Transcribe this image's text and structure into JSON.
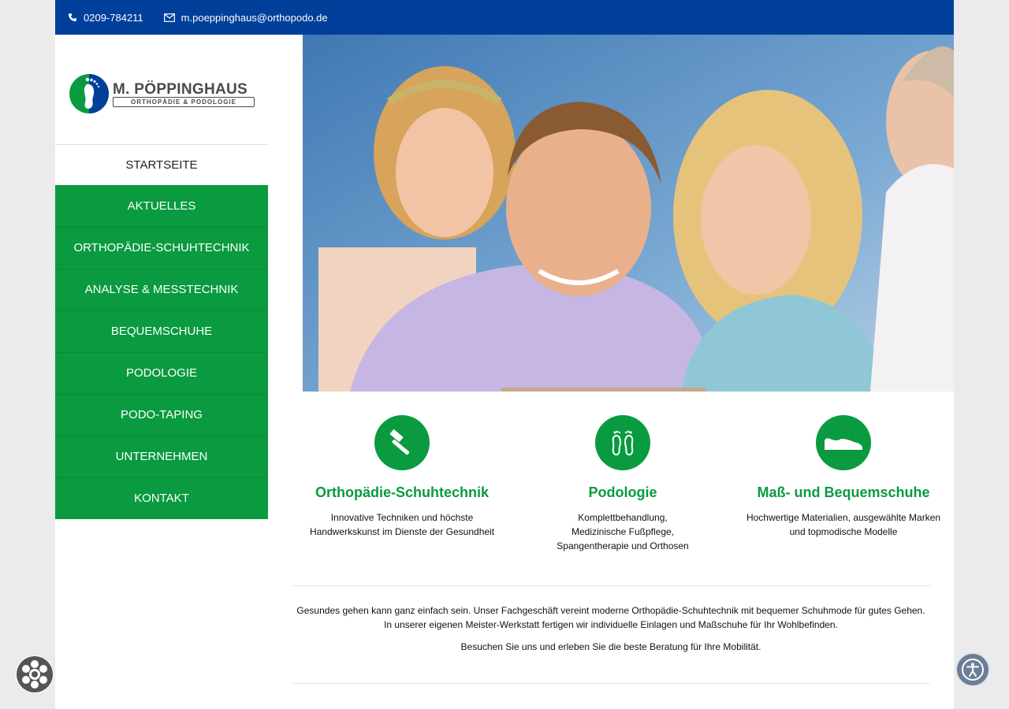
{
  "topbar": {
    "phone": "0209-784211",
    "email": "m.poeppinghaus@orthopodo.de",
    "background": "#003f9a"
  },
  "logo": {
    "name": "M. PÖPPINGHAUS",
    "subtitle": "ORTHOPÄDIE & PODOLOGIE"
  },
  "nav": {
    "start": "STARTSEITE",
    "items": [
      {
        "label": "AKTUELLES"
      },
      {
        "label": "ORTHOPÄDIE-SCHUHTECHNIK"
      },
      {
        "label": "ANALYSE & MESSTECHNIK"
      },
      {
        "label": "BEQUEMSCHUHE"
      },
      {
        "label": "PODOLOGIE"
      },
      {
        "label": "PODO-TAPING"
      },
      {
        "label": "UNTERNEHMEN"
      },
      {
        "label": "KONTAKT"
      }
    ],
    "accent": "#0a9a3f"
  },
  "features": [
    {
      "title": "Orthopädie-Schuhtechnik",
      "text_lines": [
        "Innovative Techniken und höchste",
        "Handwerkskunst im Dienste der Gesundheit"
      ],
      "icon": "hammer-icon"
    },
    {
      "title": "Podologie",
      "text_lines": [
        "Komplettbehandlung,",
        "Medizinische Fußpflege,",
        "Spangentherapie und Orthosen"
      ],
      "icon": "feet-icon"
    },
    {
      "title": "Maß- und Bequemschuhe",
      "text_lines": [
        "Hochwertige Materialien, ausgewählte Marken",
        "und topmodische Modelle"
      ],
      "icon": "shoe-icon"
    }
  ],
  "intro": {
    "line1": "Gesundes gehen kann ganz einfach sein. Unser Fachgeschäft vereint moderne Orthopädie-Schuhtechnik mit bequemer Schuhmode für gutes Gehen.",
    "line2": "In unserer eigenen Meister-Werkstatt fertigen wir individuelle Einlagen und Maßschuhe für Ihr Wohlbefinden.",
    "line3": "Besuchen Sie uns und erleben Sie die beste Beratung für Ihre Mobilität."
  }
}
